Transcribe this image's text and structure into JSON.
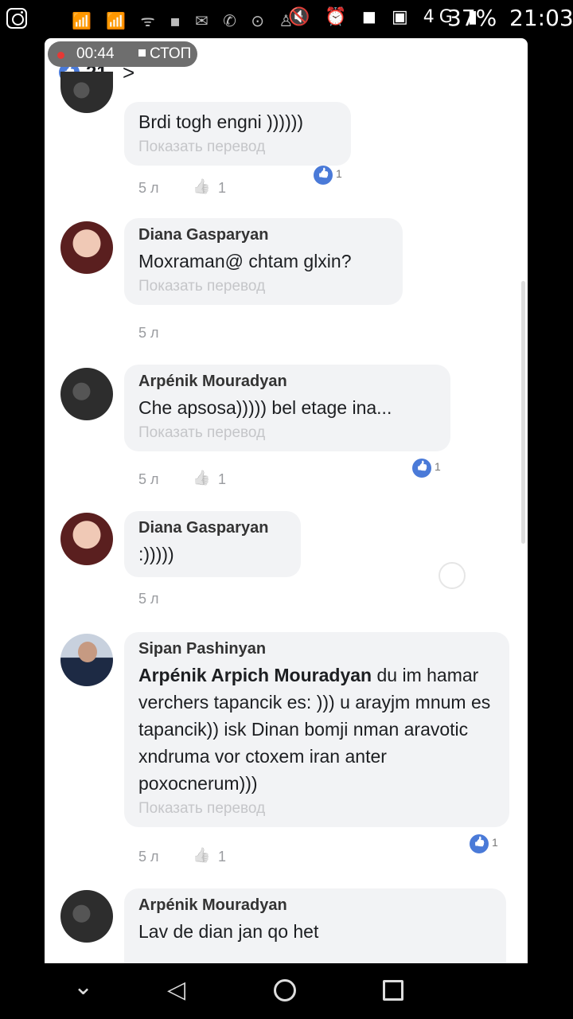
{
  "statusbar": {
    "left_icons": "📶 📶 ᯤ ▪ ✉ ✆ ⊙ ♙",
    "right_icons": "🔇 ⏰ ◼ ▣ 4G ▮",
    "battery": "37%",
    "time": "21:03"
  },
  "recorder": {
    "time": "00:44",
    "stop_label": "СТОП"
  },
  "post": {
    "likes": "21",
    "chevron": ">"
  },
  "comments": [
    {
      "name": "",
      "text": "Brdi togh engni ))))))",
      "translate": "Показать перевод",
      "age": "5 л",
      "likes": "1",
      "reactions": "1"
    },
    {
      "name": "Diana Gasparyan",
      "text": "Moxraman@ chtam glxin?",
      "translate": "Показать перевод",
      "age": "5 л"
    },
    {
      "name": "Arpénik Mouradyan",
      "text": "Che apsosa))))) bel etage ina...",
      "translate": "Показать перевод",
      "age": "5 л",
      "likes": "1",
      "reactions": "1"
    },
    {
      "name": "Diana Gasparyan",
      "text": ":)))))",
      "age": "5 л"
    },
    {
      "name": "Sipan Pashinyan",
      "mention": "Arpénik Arpich Mouradyan",
      "text": " du im hamar verchers tapancik es: ))) u arayjm mnum es tapancik)) isk Dinan bomji nman aravotic xndruma vor ctoxem iran anter poxocnerum)))",
      "translate": "Показать перевод",
      "age": "5 л",
      "likes": "1",
      "reactions": "1"
    },
    {
      "name": "Arpénik Mouradyan",
      "text": "Lav de dian jan qo het"
    }
  ],
  "navbar": {
    "back": "◁",
    "down": "⌄"
  }
}
